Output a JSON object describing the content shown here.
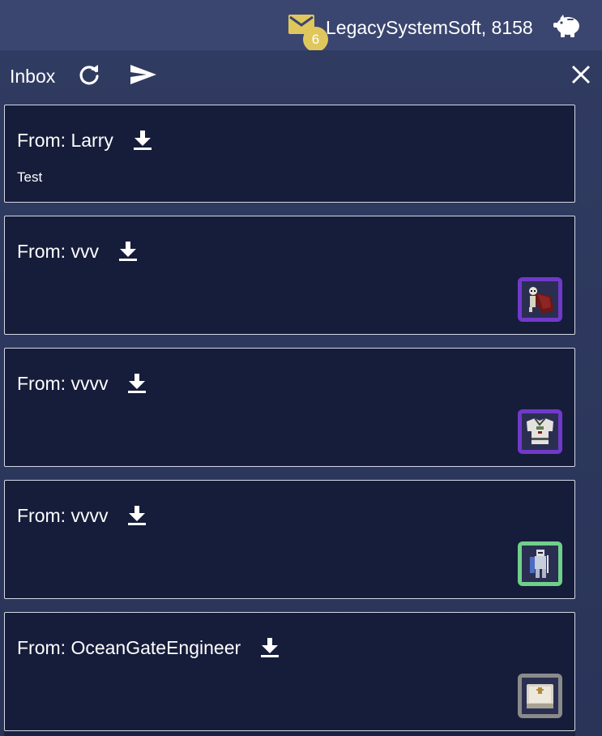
{
  "topbar": {
    "mail_icon": "envelope-icon",
    "unread_count": "6",
    "username": "LegacySystemSoft,",
    "balance": "8158",
    "currency_icon": "piggy-bank-icon"
  },
  "inbox": {
    "title": "Inbox",
    "refresh_icon": "refresh-icon",
    "send_icon": "send-icon",
    "close_icon": "close-icon",
    "from_prefix": "From: ",
    "messages": [
      {
        "sender": "Larry",
        "body": "Test",
        "attachment": null
      },
      {
        "sender": "vvv",
        "body": "",
        "attachment": {
          "icon": "cloaked-skeleton-item-icon",
          "rarity_color": "#7139c9"
        }
      },
      {
        "sender": "vvvv",
        "body": "",
        "attachment": {
          "icon": "chest-armor-item-icon",
          "rarity_color": "#7139c9"
        }
      },
      {
        "sender": "vvvv",
        "body": "",
        "attachment": {
          "icon": "knight-figure-item-icon",
          "rarity_color": "#6fd08a"
        }
      },
      {
        "sender": "OceanGateEngineer",
        "body": "",
        "attachment": {
          "icon": "book-item-icon",
          "rarity_color": "#8a8a8a"
        }
      }
    ]
  },
  "colors": {
    "topbar_bg": "#3a4670",
    "panel_bg": "#2c3658",
    "card_bg": "#161d3a",
    "badge_bg": "#dfc75d",
    "envelope": "#dfc75d"
  }
}
